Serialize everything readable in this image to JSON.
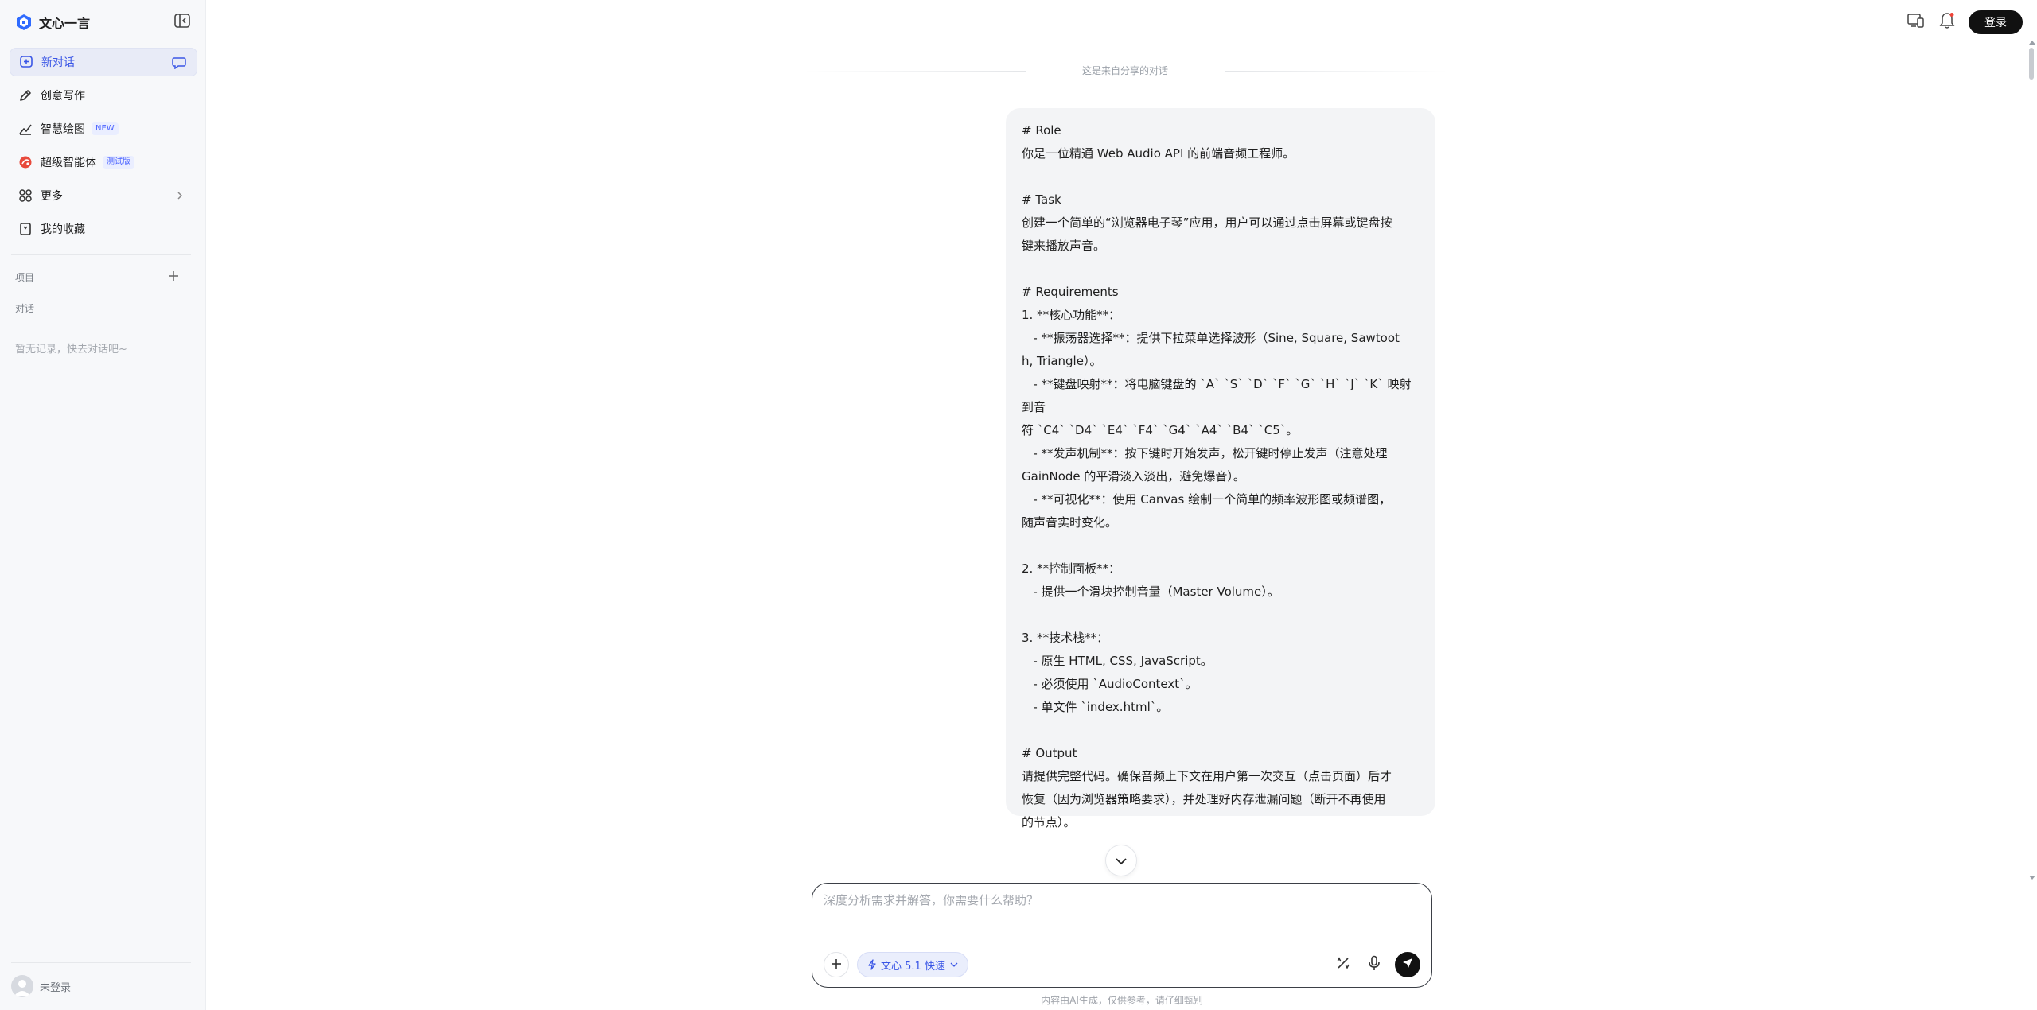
{
  "app": {
    "name": "文心一言"
  },
  "sidebar": {
    "items": [
      {
        "label": "新对话",
        "icon": "new-chat-icon"
      },
      {
        "label": "创意写作",
        "icon": "pen-icon"
      },
      {
        "label": "智慧绘图",
        "icon": "draw-icon",
        "badge": "NEW"
      },
      {
        "label": "超级智能体",
        "icon": "agent-icon",
        "badge": "测试版"
      },
      {
        "label": "更多",
        "icon": "grid-icon"
      },
      {
        "label": "我的收藏",
        "icon": "bookmark-icon"
      }
    ],
    "sections": {
      "projects": "项目",
      "chats": "对话"
    },
    "empty_hint": "暂无记录，快去对话吧~",
    "user_label": "未登录"
  },
  "header": {
    "login_label": "登录"
  },
  "conversation": {
    "share_notice": "这是来自分享的对话",
    "message_lines": [
      "# Role",
      "你是一位精通 Web Audio API 的前端音频工程师。",
      "",
      "# Task",
      "创建一个简单的“浏览器电子琴”应用，用户可以通过点击屏幕或键盘按",
      "键来播放声音。",
      "",
      "# Requirements",
      "1. **核心功能**：",
      "   - **振荡器选择**：提供下拉菜单选择波形（Sine, Square, Sawtoot",
      "h, Triangle）。",
      "   - **键盘映射**：将电脑键盘的 `A` `S` `D` `F` `G` `H` `J` `K` 映射到音",
      "符 `C4` `D4` `E4` `F4` `G4` `A4` `B4` `C5`。",
      "   - **发声机制**：按下键时开始发声，松开键时停止发声（注意处理",
      "GainNode 的平滑淡入淡出，避免爆音）。",
      "   - **可视化**：使用 Canvas 绘制一个简单的频率波形图或频谱图，",
      "随声音实时变化。",
      "",
      "2. **控制面板**：",
      "   - 提供一个滑块控制音量（Master Volume）。",
      "",
      "3. **技术栈**：",
      "   - 原生 HTML, CSS, JavaScript。",
      "   - 必须使用 `AudioContext`。",
      "   - 单文件 `index.html`。",
      "",
      "# Output",
      "请提供完整代码。确保音频上下文在用户第一次交互（点击页面）后才",
      "恢复（因为浏览器策略要求），并处理好内存泄漏问题（断开不再使用",
      "的节点）。"
    ]
  },
  "input": {
    "placeholder": "深度分析需求并解答，你需要什么帮助？",
    "model_label": "文心 5.1 快速"
  },
  "footer": {
    "disclaimer": "内容由AI生成，仅供参考，请仔细甄别"
  },
  "colors": {
    "accent": "#3a56e6",
    "sidebar_bg": "#f7f8fa",
    "bubble_bg": "#f3f4f6"
  }
}
